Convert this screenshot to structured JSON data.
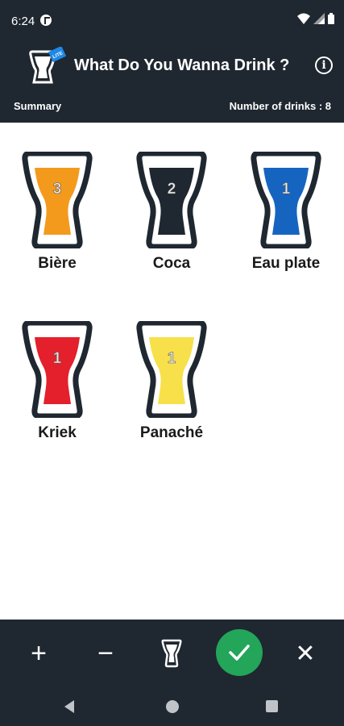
{
  "status_bar": {
    "time": "6:24"
  },
  "app": {
    "title": "What Do You Wanna Drink ?",
    "logo_badge": "LITE"
  },
  "summary": {
    "label": "Summary",
    "count_label": "Number of drinks : 8"
  },
  "drinks": [
    {
      "name": "Bière",
      "count": "3",
      "color": "#f39a1d"
    },
    {
      "name": "Coca",
      "count": "2",
      "color": "#1f2730"
    },
    {
      "name": "Eau plate",
      "count": "1",
      "color": "#1565c0"
    },
    {
      "name": "Kriek",
      "count": "1",
      "color": "#e3202b"
    },
    {
      "name": "Panaché",
      "count": "1",
      "color": "#f7e04a"
    }
  ],
  "actions": {
    "add": "+",
    "remove": "−",
    "cancel": "✕",
    "confirm_icon": "check-icon",
    "glass_icon": "beer-glass-icon"
  },
  "colors": {
    "bar": "#1f2730",
    "confirm": "#23a55a"
  }
}
